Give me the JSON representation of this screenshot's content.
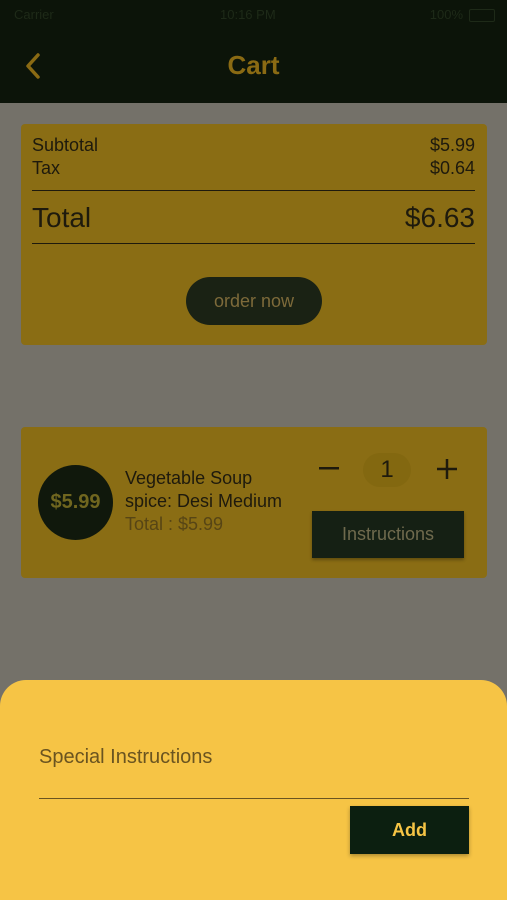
{
  "status_bar": {
    "carrier": "Carrier",
    "time": "10:16 PM",
    "battery_label": "100%"
  },
  "header": {
    "title": "Cart"
  },
  "summary": {
    "subtotal_label": "Subtotal",
    "subtotal_value": "$5.99",
    "tax_label": "Tax",
    "tax_value": "$0.64",
    "total_label": "Total",
    "total_value": "$6.63",
    "order_button": "order now"
  },
  "cart_items": [
    {
      "price_badge": "$5.99",
      "name": "Vegetable Soup",
      "spice": "spice: Desi Medium",
      "total": "Total : $5.99",
      "quantity": "1",
      "instructions_button": "Instructions"
    }
  ],
  "instructions_sheet": {
    "placeholder": "Special Instructions",
    "value": "",
    "add_button": "Add"
  },
  "colors": {
    "appbar": "#0c1409",
    "accent": "#f6c445",
    "dim_overlay": "#747169",
    "card_dimmed": "#8a6d14",
    "button_dark": "#0c1f10"
  },
  "icons": {
    "back": "chevron-left-icon",
    "minus": "minus-icon",
    "plus": "plus-icon"
  }
}
